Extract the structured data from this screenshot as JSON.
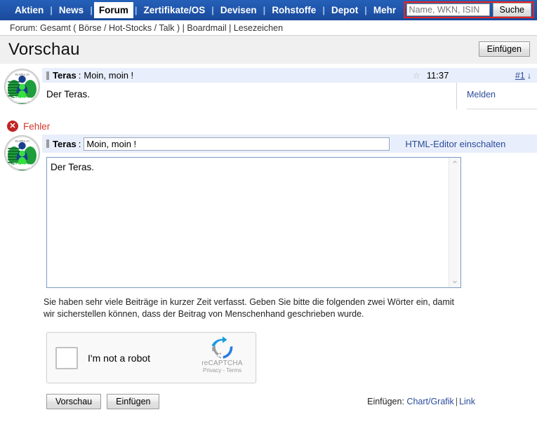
{
  "nav": {
    "items": [
      {
        "label": "Aktien",
        "active": false
      },
      {
        "label": "News",
        "active": false
      },
      {
        "label": "Forum",
        "active": true
      },
      {
        "label": "Zertifikate/OS",
        "active": false
      },
      {
        "label": "Devisen",
        "active": false
      },
      {
        "label": "Rohstoffe",
        "active": false
      },
      {
        "label": "Depot",
        "active": false
      },
      {
        "label": "Mehr",
        "active": false
      }
    ],
    "separator": "|",
    "search": {
      "placeholder": "Name, WKN, ISIN",
      "value": "",
      "button_label": "Suche",
      "highlight_color": "#e8241f"
    }
  },
  "breadcrumb": {
    "text": "Forum: Gesamt ( Börse / Hot-Stocks / Talk ) | Boardmail | Lesezeichen"
  },
  "titlebar": {
    "title": "Vorschau",
    "insert_label": "Einfügen"
  },
  "preview_post": {
    "avatar_name": "Teras",
    "username": "Teras",
    "separator": ":",
    "subject": "Moin, moin !",
    "star_icon": "☆",
    "time": "11:37",
    "post_number": "#1",
    "down_arrow": "↓",
    "body": "Der Teras.",
    "report_link": "Melden"
  },
  "error": {
    "icon": "✕",
    "text": "Fehler"
  },
  "edit_form": {
    "username": "Teras",
    "separator": ":",
    "subject_value": "Moin, moin !",
    "subject_placeholder": "",
    "html_editor_link": "HTML-Editor einschalten",
    "body_value": "Der Teras.",
    "scroll_up": "⌃",
    "scroll_down": "⌄",
    "hint": "Sie haben sehr viele Beiträge in kurzer Zeit verfasst. Geben Sie bitte die folgenden zwei Wörter ein, damit wir sicherstellen können, dass der Beitrag von Menschenhand geschrieben wurde."
  },
  "captcha": {
    "label": "I'm not a robot",
    "brand": "reCAPTCHA",
    "terms": "Privacy - Terms",
    "checked": false
  },
  "footer": {
    "preview_label": "Vorschau",
    "insert_label": "Einfügen",
    "insert_prefix": "Einfügen:",
    "chart_link": "Chart/Grafik",
    "link_sep": "|",
    "link_link": "Link"
  }
}
